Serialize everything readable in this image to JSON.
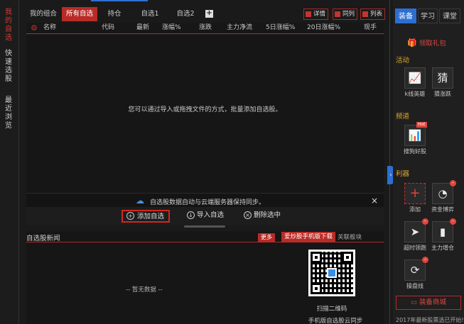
{
  "colors": {
    "accent_red": "#b92b27",
    "accent_blue": "#2d6fd1",
    "section_gold": "#e0a92a",
    "background": "#1a1a1a"
  },
  "left_nav": {
    "items": [
      {
        "label": "我的自选",
        "color": "#d43a33"
      },
      {
        "label": "快速选股",
        "color": "#cfcfcf"
      },
      {
        "label": "最近浏览",
        "color": "#cfcfcf"
      }
    ]
  },
  "tabs": [
    {
      "label": "我的组合",
      "active": false
    },
    {
      "label": "所有自选",
      "active": true
    },
    {
      "label": "持仓",
      "active": false
    },
    {
      "label": "自选1",
      "active": false
    },
    {
      "label": "自选2",
      "active": false
    }
  ],
  "add_tab_label": "+",
  "view_buttons": [
    {
      "label": "详情",
      "icon": "details-icon"
    },
    {
      "label": "同列",
      "icon": "columns-icon"
    },
    {
      "label": "列表",
      "icon": "list-icon"
    }
  ],
  "table": {
    "columns": [
      "名称",
      "代码",
      "最新",
      "涨幅%",
      "涨跌",
      "主力净流",
      "5日涨幅%",
      "20日涨幅%",
      "现手"
    ],
    "empty_message": "您可以通过导入或拖拽文件的方式，批量添加自选股。"
  },
  "sync_bar": {
    "icon": "cloud-icon",
    "text": "自选股数据自动与云端服务器保持同步。",
    "close_label": "×"
  },
  "actions": [
    {
      "label": "添加自选",
      "icon": "plus-circle-icon",
      "highlighted": true
    },
    {
      "label": "导入自选",
      "icon": "import-icon",
      "highlighted": false
    },
    {
      "label": "删除选中",
      "icon": "delete-icon",
      "highlighted": false
    }
  ],
  "news": {
    "title": "自选股新闻",
    "more_label": "更多",
    "download_label": "爱炒股手机版下载",
    "related_label": "关联板块",
    "no_data": "-- 暂无数据 --",
    "qr_caption": "扫描二维码",
    "qr_subcaption": "手机版自选股云同步"
  },
  "right_panel": {
    "tabs": [
      {
        "label": "装备",
        "active": true
      },
      {
        "label": "学习",
        "active": false
      },
      {
        "label": "课堂",
        "active": false
      }
    ],
    "gift_label": "领取礼包",
    "sections": {
      "activity": "活动",
      "channel": "频道",
      "tools": "利器"
    },
    "activity_items": [
      {
        "label": "k线英雄",
        "icon": "kline-hero-icon"
      },
      {
        "label": "猜涨跌",
        "icon": "guess-icon"
      }
    ],
    "channel_items": [
      {
        "label": "搜狗好股",
        "icon": "good-stock-icon",
        "badge": "Hot"
      }
    ],
    "tool_items": [
      {
        "label": "添加",
        "icon": "add-plus-icon"
      },
      {
        "label": "资金博弈",
        "icon": "fund-game-icon"
      },
      {
        "label": "超时领跑",
        "icon": "lead-run-icon"
      },
      {
        "label": "主力增仓",
        "icon": "main-position-icon"
      },
      {
        "label": "操盘线",
        "icon": "trade-line-icon"
      }
    ],
    "shop_button": "装备商城",
    "bottom_note": "2017年最新股票选已开始!"
  }
}
